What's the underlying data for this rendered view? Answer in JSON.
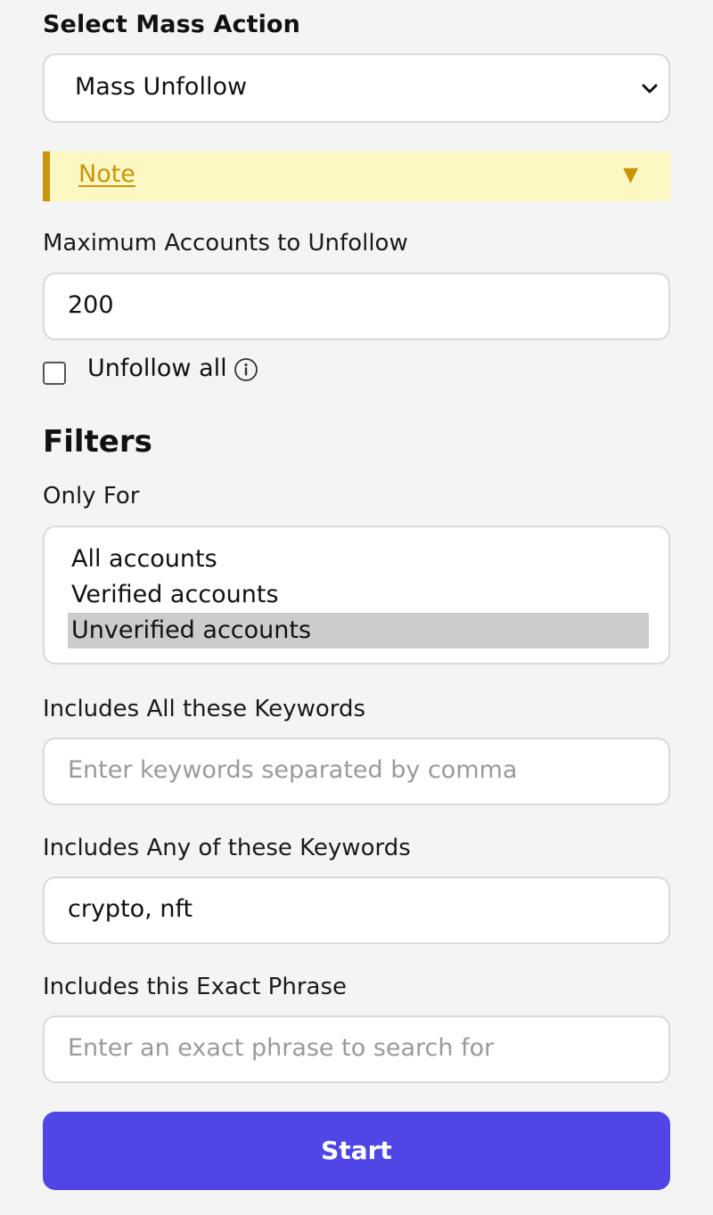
{
  "mass_action": {
    "label": "Select Mass Action",
    "selected": "Mass Unfollow",
    "icon": "chevron-down-icon"
  },
  "note": {
    "label": "Note",
    "icon": "caret-down-icon",
    "accent_color": "#c9940a",
    "bg_color": "#fdf7c3"
  },
  "max_accounts": {
    "label": "Maximum Accounts to Unfollow",
    "value": "200"
  },
  "unfollow_all": {
    "label": "Unfollow all",
    "checked": false,
    "icon": "info-icon"
  },
  "filters": {
    "title": "Filters",
    "only_for": {
      "label": "Only For",
      "options": [
        "All accounts",
        "Verified accounts",
        "Unverified accounts"
      ],
      "selected": "Unverified accounts"
    },
    "all_keywords": {
      "label": "Includes All these Keywords",
      "value": "",
      "placeholder": "Enter keywords separated by comma"
    },
    "any_keywords": {
      "label": "Includes Any of these Keywords",
      "value": "crypto, nft"
    },
    "exact_phrase": {
      "label": "Includes this Exact Phrase",
      "value": "",
      "placeholder": "Enter an exact phrase to search for"
    }
  },
  "start_button": {
    "label": "Start",
    "color": "#4f46e5"
  }
}
